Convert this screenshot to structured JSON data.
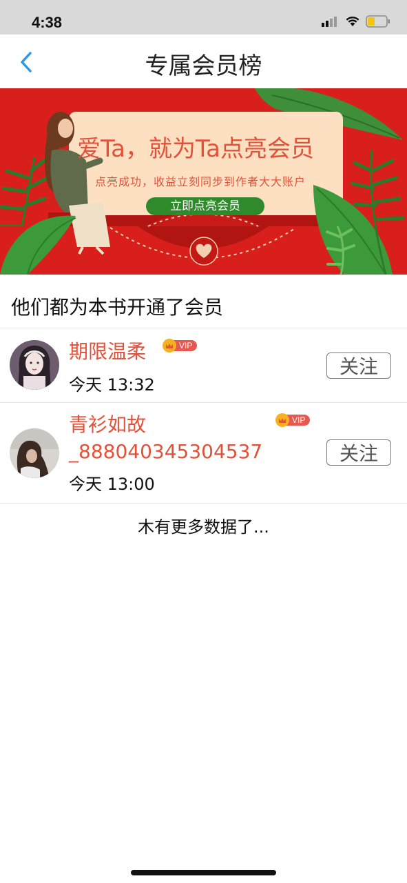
{
  "status_bar": {
    "time": "4:38"
  },
  "nav": {
    "title": "专属会员榜"
  },
  "banner": {
    "headline": "爱Ta，就为Ta点亮会员",
    "subtitle": "点亮成功，收益立刻同步到作者大大账户",
    "cta_label": "立即点亮会员"
  },
  "section": {
    "title": "他们都为本书开通了会员"
  },
  "members": [
    {
      "name": "期限温柔",
      "vip_label": "VIP",
      "time": "今天 13:32",
      "follow_label": "关注"
    },
    {
      "name_line1": "青衫如故",
      "name_line2": "_888040345304537",
      "vip_label": "VIP",
      "time": "今天 13:00",
      "follow_label": "关注"
    }
  ],
  "footer": {
    "no_more_text": "木有更多数据了..."
  },
  "colors": {
    "accent": "#e2513a",
    "banner_red": "#d81f1c",
    "banner_green": "#2f8a2c",
    "back_arrow": "#2a9ae8"
  }
}
